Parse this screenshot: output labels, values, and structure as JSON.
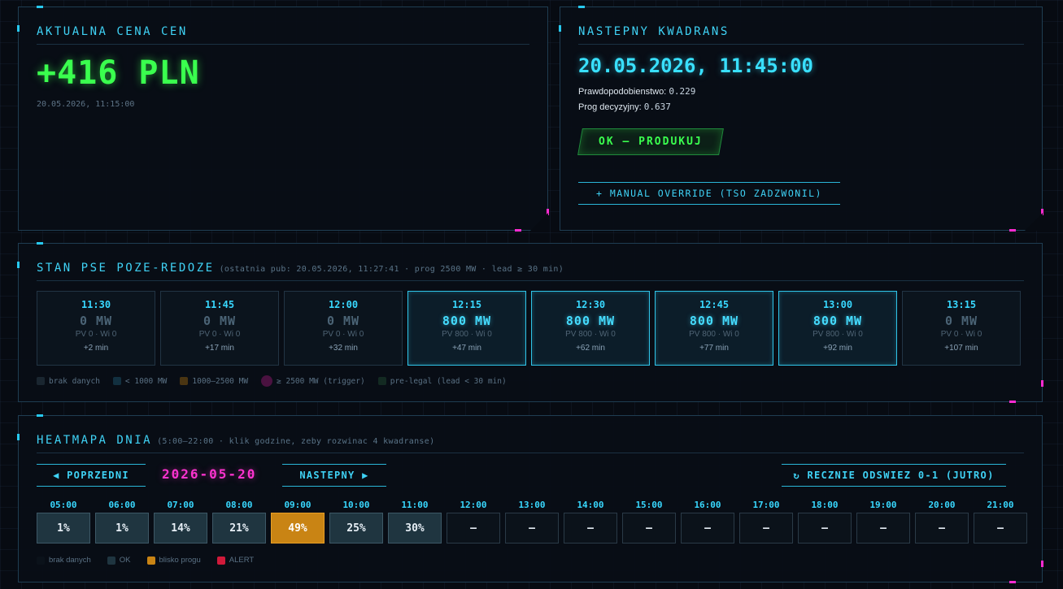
{
  "price_panel": {
    "title": "AKTUALNA CENA CEN",
    "price": "+416 PLN",
    "timestamp": "20.05.2026, 11:15:00"
  },
  "next_panel": {
    "title": "NASTEPNY KWADRANS",
    "datetime": "20.05.2026, 11:45:00",
    "prob_label": "Prawdopodobienstwo:",
    "prob_value": "0.229",
    "thresh_label": "Prog decyzyjny:",
    "thresh_value": "0.637",
    "ok_button": "OK — PRODUKUJ",
    "override_button": "+ MANUAL OVERRIDE (TSO ZADZWONIL)"
  },
  "pse_panel": {
    "title": "STAN PSE POZE-REDOZE",
    "subtitle": "(ostatnia pub: 20.05.2026, 11:27:41 · prog 2500 MW · lead ≥ 30 min)",
    "cards": [
      {
        "time": "11:30",
        "mw": "0 MW",
        "pv": "PV 0 · Wi 0",
        "delta": "+2 min",
        "active": false
      },
      {
        "time": "11:45",
        "mw": "0 MW",
        "pv": "PV 0 · Wi 0",
        "delta": "+17 min",
        "active": false
      },
      {
        "time": "12:00",
        "mw": "0 MW",
        "pv": "PV 0 · Wi 0",
        "delta": "+32 min",
        "active": false
      },
      {
        "time": "12:15",
        "mw": "800 MW",
        "pv": "PV 800 · Wi 0",
        "delta": "+47 min",
        "active": true
      },
      {
        "time": "12:30",
        "mw": "800 MW",
        "pv": "PV 800 · Wi 0",
        "delta": "+62 min",
        "active": true
      },
      {
        "time": "12:45",
        "mw": "800 MW",
        "pv": "PV 800 · Wi 0",
        "delta": "+77 min",
        "active": true
      },
      {
        "time": "13:00",
        "mw": "800 MW",
        "pv": "PV 800 · Wi 0",
        "delta": "+92 min",
        "active": true
      },
      {
        "time": "13:15",
        "mw": "0 MW",
        "pv": "PV 0 · Wi 0",
        "delta": "+107 min",
        "active": false
      }
    ],
    "legend": [
      {
        "label": "brak danych",
        "color": "#1a2630"
      },
      {
        "label": "< 1000 MW",
        "color": "#123040"
      },
      {
        "label": "1000–2500 MW",
        "color": "#4a3512"
      },
      {
        "label": "≥ 2500 MW (trigger)",
        "color": "#4a1240"
      },
      {
        "label": "pre-legal (lead < 30 min)",
        "color": "#132a22"
      }
    ]
  },
  "heatmap_panel": {
    "title": "HEATMAPA DNIA",
    "subtitle": "(5:00–22:00 · klik godzine, zeby rozwinac 4 kwadranse)",
    "prev_button": "◀ POPRZEDNI",
    "date": "2026-05-20",
    "next_button": "NASTEPNY ▶",
    "refresh_button": "↻ RECZNIE ODSWIEZ 0-1 (JUTRO)",
    "hours": [
      {
        "label": "05:00",
        "value": "1%",
        "state": "ok"
      },
      {
        "label": "06:00",
        "value": "1%",
        "state": "ok"
      },
      {
        "label": "07:00",
        "value": "14%",
        "state": "ok"
      },
      {
        "label": "08:00",
        "value": "21%",
        "state": "ok"
      },
      {
        "label": "09:00",
        "value": "49%",
        "state": "near"
      },
      {
        "label": "10:00",
        "value": "25%",
        "state": "ok"
      },
      {
        "label": "11:00",
        "value": "30%",
        "state": "ok"
      },
      {
        "label": "12:00",
        "value": "—",
        "state": "none"
      },
      {
        "label": "13:00",
        "value": "—",
        "state": "none"
      },
      {
        "label": "14:00",
        "value": "—",
        "state": "none"
      },
      {
        "label": "15:00",
        "value": "—",
        "state": "none"
      },
      {
        "label": "16:00",
        "value": "—",
        "state": "none"
      },
      {
        "label": "17:00",
        "value": "—",
        "state": "none"
      },
      {
        "label": "18:00",
        "value": "—",
        "state": "none"
      },
      {
        "label": "19:00",
        "value": "—",
        "state": "none"
      },
      {
        "label": "20:00",
        "value": "—",
        "state": "none"
      },
      {
        "label": "21:00",
        "value": "—",
        "state": "none"
      }
    ],
    "legend": [
      {
        "label": "brak danych",
        "color": "#0b121a"
      },
      {
        "label": "OK",
        "color": "#1f3540"
      },
      {
        "label": "blisko progu",
        "color": "#c98414"
      },
      {
        "label": "ALERT",
        "color": "#d01a3a"
      }
    ]
  }
}
